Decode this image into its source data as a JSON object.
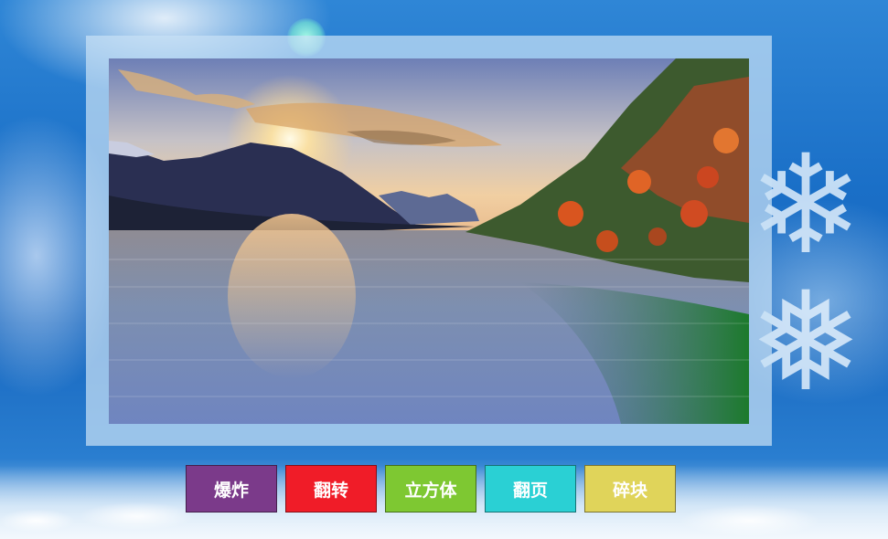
{
  "buttons": [
    {
      "label": "爆炸",
      "color": "#7b3a8a"
    },
    {
      "label": "翻转",
      "color": "#f01c28"
    },
    {
      "label": "立方体",
      "color": "#7ec832"
    },
    {
      "label": "翻页",
      "color": "#2ad0d4"
    },
    {
      "label": "碎块",
      "color": "#e0d45a"
    }
  ],
  "background": {
    "accent": "#1767bf",
    "frame_color": "#c8e1f5"
  },
  "slide": {
    "scene": "mountain-lake-sunset-image"
  }
}
